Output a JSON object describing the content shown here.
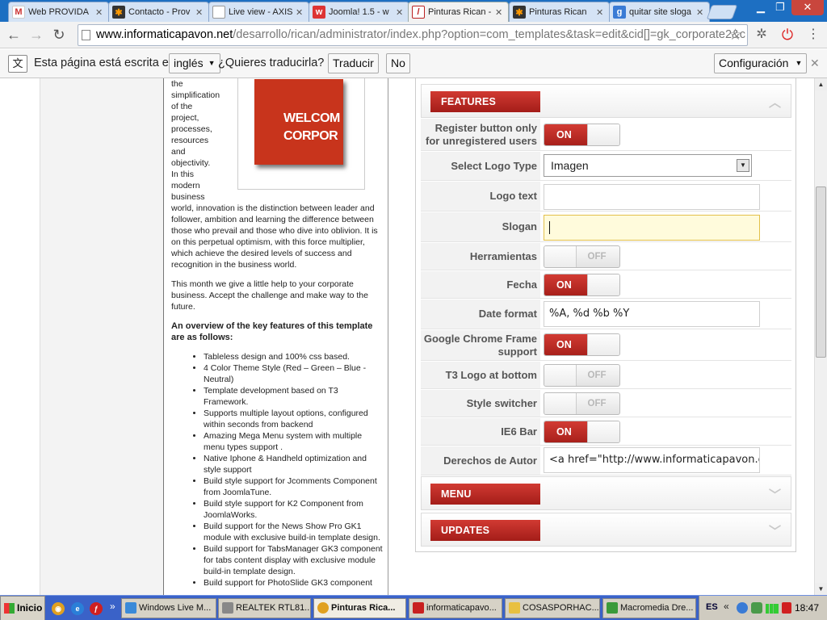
{
  "browser": {
    "tabs": [
      {
        "label": "Web PROVIDA",
        "icon": "gmail-icon"
      },
      {
        "label": "Contacto - Prov",
        "icon": "joomla-icon"
      },
      {
        "label": "Live view - AXIS",
        "icon": "document-icon"
      },
      {
        "label": "Joomla! 1.5 - w",
        "icon": "wix-icon"
      },
      {
        "label": "Pinturas Rican -",
        "icon": "rican-icon",
        "active": true
      },
      {
        "label": "Pinturas Rican",
        "icon": "joomla-icon"
      },
      {
        "label": "quitar site sloga",
        "icon": "google-icon"
      }
    ],
    "url_host": "www.informaticapavon.net",
    "url_path": "/desarrollo/rican/administrator/index.php?option=com_templates&task=edit&cid[]=gk_corporate2&c"
  },
  "translate_bar": {
    "prompt": "Esta página está escrita en",
    "language": "inglés",
    "question": "¿Quieres traducirla?",
    "translate_label": "Traducir",
    "no_label": "No",
    "options_label": "Configuración"
  },
  "article": {
    "intro_words": [
      "the",
      "simplification",
      "of the",
      "project,",
      "processes,",
      "resources",
      "and",
      "objectivity.",
      "In this",
      "modern",
      "business"
    ],
    "intro_rest": "world, innovation is the distinction between leader and follower, ambition and learning the difference between those who prevail and those who dive into oblivion. It is on this perpetual optimism, with this force multiplier, which achieve the desired levels of success and recognition in the business world.",
    "paragraph2": "This month we give a little help to your corporate business. Accept the challenge and make way to the future.",
    "heading": "An overview of the key features of this template are as follows:",
    "features": [
      "Tableless design and 100% css based.",
      "4 Color Theme Style (Red – Green – Blue - Neutral)",
      "Template development based on T3 Framework.",
      "Supports multiple layout options, configured within seconds from backend",
      "Amazing Mega Menu system with multiple menu types support .",
      "Native Iphone & Handheld optimization and style support",
      "Build style support for Jcomments Component from JoomlaTune.",
      "Build style support for K2 Component from JoomlaWorks.",
      "Build support for the News Show Pro GK1 module with exclusive build-in template design.",
      "Build support for TabsManager GK3 component for tabs content display with exclusive module build-in template design.",
      "Build support for PhotoSlide GK3 component"
    ],
    "image_text_1": "WELCOM",
    "image_text_2": "CORPOR"
  },
  "panel": {
    "features_label": "FEATURES",
    "menu_label": "MENU",
    "updates_label": "UPDATES",
    "on_label": "ON",
    "off_label": "OFF",
    "fields": {
      "register_button": {
        "label": "Register button only for unregistered users",
        "state": "ON"
      },
      "logo_type": {
        "label": "Select Logo Type",
        "value": "Imagen"
      },
      "logo_text": {
        "label": "Logo text",
        "value": ""
      },
      "slogan": {
        "label": "Slogan",
        "value": ""
      },
      "herramientas": {
        "label": "Herramientas",
        "state": "OFF"
      },
      "fecha": {
        "label": "Fecha",
        "state": "ON"
      },
      "date_format": {
        "label": "Date format",
        "value": "%A, %d %b %Y"
      },
      "chrome_frame": {
        "label": "Google Chrome Frame support",
        "state": "ON"
      },
      "t3_logo": {
        "label": "T3 Logo at bottom",
        "state": "OFF"
      },
      "style_switcher": {
        "label": "Style switcher",
        "state": "OFF"
      },
      "ie6_bar": {
        "label": "IE6 Bar",
        "state": "ON"
      },
      "copyright": {
        "label": "Derechos de Autor",
        "value": "<a href=\"http://www.informaticapavon.com"
      }
    }
  },
  "taskbar": {
    "start_label": "Inicio",
    "buttons": [
      {
        "label": "Windows Live M..."
      },
      {
        "label": "REALTEK RTL81..."
      },
      {
        "label": "Pinturas Rica...",
        "active": true
      },
      {
        "label": "informaticapavo..."
      },
      {
        "label": "COSASPORHAC..."
      },
      {
        "label": "Macromedia Dre..."
      }
    ],
    "tray_lang": "ES",
    "clock": "18:47"
  }
}
